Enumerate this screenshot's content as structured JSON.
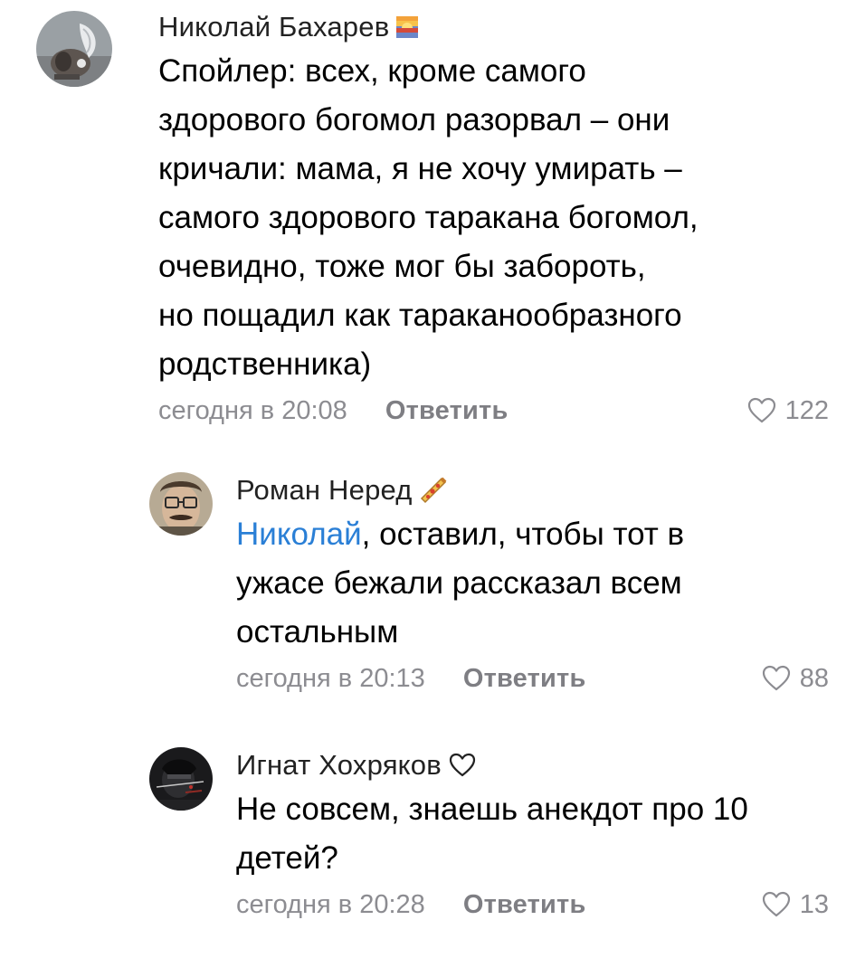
{
  "comments": [
    {
      "author": "Николай Бахарев",
      "author_badge": "sunset-emoji",
      "text_lines": [
        "Спойлер: всех, кроме самого",
        "здорового богомол разорвал – они",
        "кричали: мама, я не хочу умирать –",
        "самого здорового таракана богомол,",
        "очевидно, тоже мог бы забороть,",
        "но пощадил как тараканообразного",
        "родственника)"
      ],
      "date": "сегодня в 20:08",
      "reply_label": "Ответить",
      "likes": "122"
    },
    {
      "author": "Роман Неред",
      "author_badge": "pizza-emoji",
      "mention": "Николай",
      "text_lines": [
        ", оставил, чтобы тот в",
        "ужасе бежали рассказал всем",
        "остальным"
      ],
      "date": "сегодня в 20:13",
      "reply_label": "Ответить",
      "likes": "88"
    },
    {
      "author": "Игнат Хохряков",
      "author_badge": "heart-outline-emoji",
      "text_lines": [
        "Не совсем, знаешь анекдот про 10",
        "детей?"
      ],
      "date": "сегодня в 20:28",
      "reply_label": "Ответить",
      "likes": "13"
    }
  ],
  "colors": {
    "text": "#000000",
    "author": "#222222",
    "meta": "#8c8c91",
    "mention": "#2a7fd6",
    "background": "#ffffff"
  }
}
